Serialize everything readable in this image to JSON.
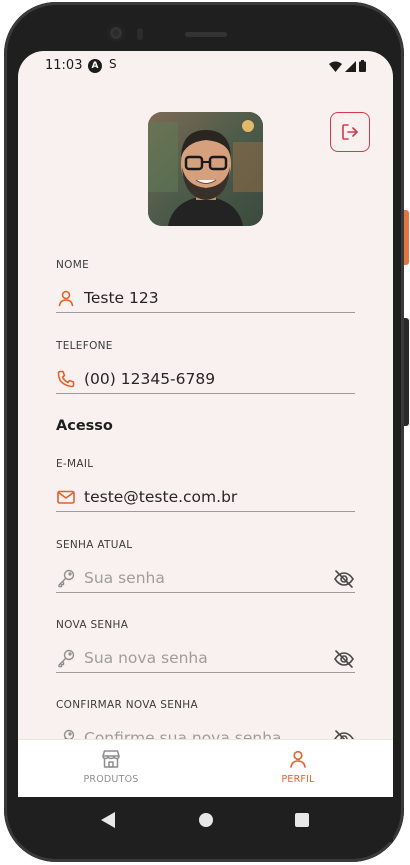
{
  "status_bar": {
    "time": "11:03",
    "app_icon_a": "A",
    "app_icon_s": "S"
  },
  "header": {
    "avatar_alt": "profile photo",
    "logout_icon": "logout-icon"
  },
  "profile": {
    "name": {
      "label": "NOME",
      "value": "Teste 123",
      "icon": "user-icon"
    },
    "phone": {
      "label": "TELEFONE",
      "value": "(00) 12345-6789",
      "icon": "phone-icon"
    }
  },
  "access": {
    "title": "Acesso",
    "email": {
      "label": "E-MAIL",
      "value": "teste@teste.com.br",
      "icon": "mail-icon"
    },
    "current_password": {
      "label": "SENHA ATUAL",
      "placeholder": "Sua senha",
      "icon": "key-icon"
    },
    "new_password": {
      "label": "NOVA SENHA",
      "placeholder": "Sua nova senha",
      "icon": "key-icon"
    },
    "confirm_password": {
      "label": "CONFIRMAR NOVA SENHA",
      "placeholder": "Confirme sua nova senha",
      "icon": "key-icon"
    }
  },
  "bottom_nav": {
    "items": [
      {
        "label": "PRODUTOS",
        "icon": "store-icon",
        "active": false
      },
      {
        "label": "PERFIL",
        "icon": "user-icon",
        "active": true
      }
    ]
  },
  "colors": {
    "accent": "#e0622d",
    "danger": "#d33a4a",
    "background": "#f9f1f0",
    "inactive": "#8e8e8e"
  }
}
